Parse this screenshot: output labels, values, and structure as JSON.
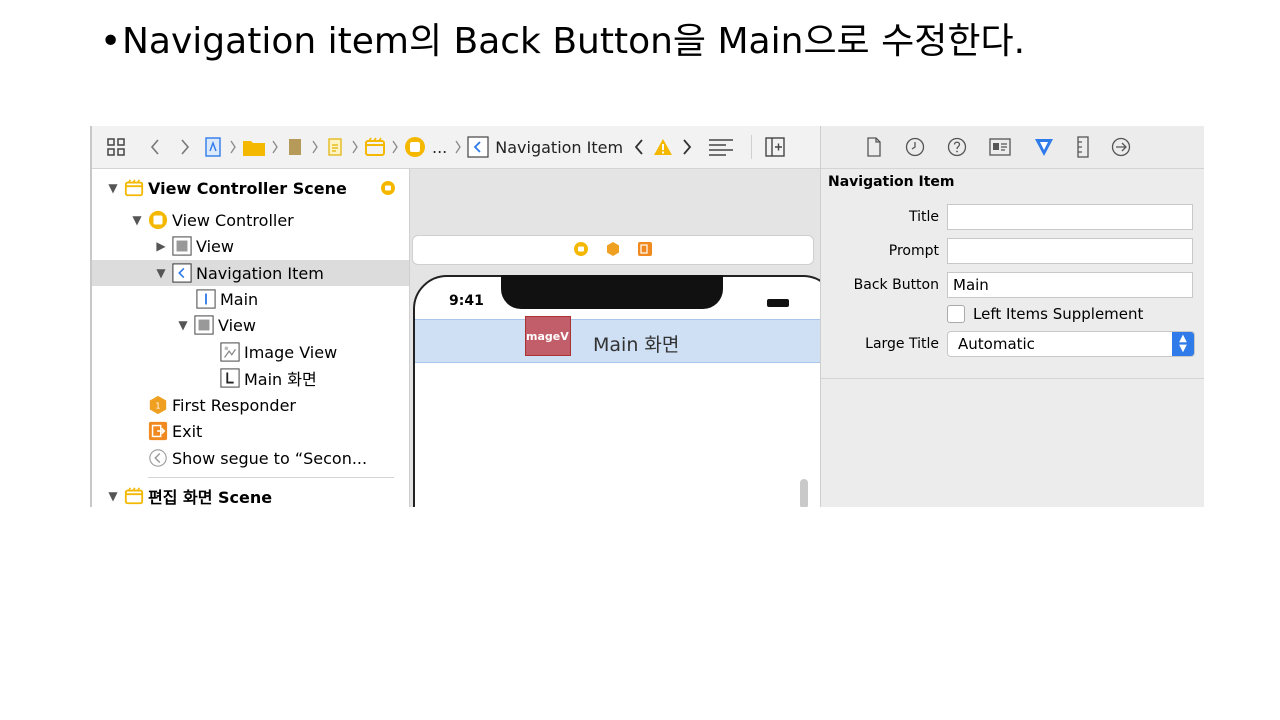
{
  "slide": {
    "bullet": "•",
    "title": "Navigation item의 Back Button을 Main으로 수정한다."
  },
  "jumpbar": {
    "ellipsis": "...",
    "current_item": "Navigation Item"
  },
  "outline": {
    "items": [
      {
        "label": "View Controller Scene",
        "icon": "scene-icon"
      },
      {
        "label": "View Controller",
        "icon": "view-controller-icon"
      },
      {
        "label": "View",
        "icon": "view-icon"
      },
      {
        "label": "Navigation Item",
        "icon": "navigation-item-icon"
      },
      {
        "label": "Main",
        "icon": "bar-button-item-icon"
      },
      {
        "label": "View",
        "icon": "view-icon"
      },
      {
        "label": "Image View",
        "icon": "image-view-icon"
      },
      {
        "label": "Main 화면",
        "icon": "label-icon"
      },
      {
        "label": "First Responder",
        "icon": "first-responder-icon"
      },
      {
        "label": "Exit",
        "icon": "exit-icon"
      },
      {
        "label": "Show segue to “Secon...",
        "icon": "segue-icon"
      },
      {
        "label": "편집 화면 Scene",
        "icon": "scene-icon"
      }
    ]
  },
  "canvas": {
    "time": "9:41",
    "image_view_label": "mageV",
    "nav_title": "Main 화면"
  },
  "inspector": {
    "section_title": "Navigation Item",
    "title_label": "Title",
    "title_value": "",
    "prompt_label": "Prompt",
    "prompt_value": "",
    "back_button_label": "Back Button",
    "back_button_value": "Main",
    "left_items_supplement_label": "Left Items Supplement",
    "left_items_supplement_checked": false,
    "large_title_label": "Large Title",
    "large_title_value": "Automatic"
  },
  "colors": {
    "accent": "#2f7bea",
    "scene_icon": "#f5b800",
    "navbar_bg": "#cfe0f5",
    "warning": "#f5b800"
  }
}
